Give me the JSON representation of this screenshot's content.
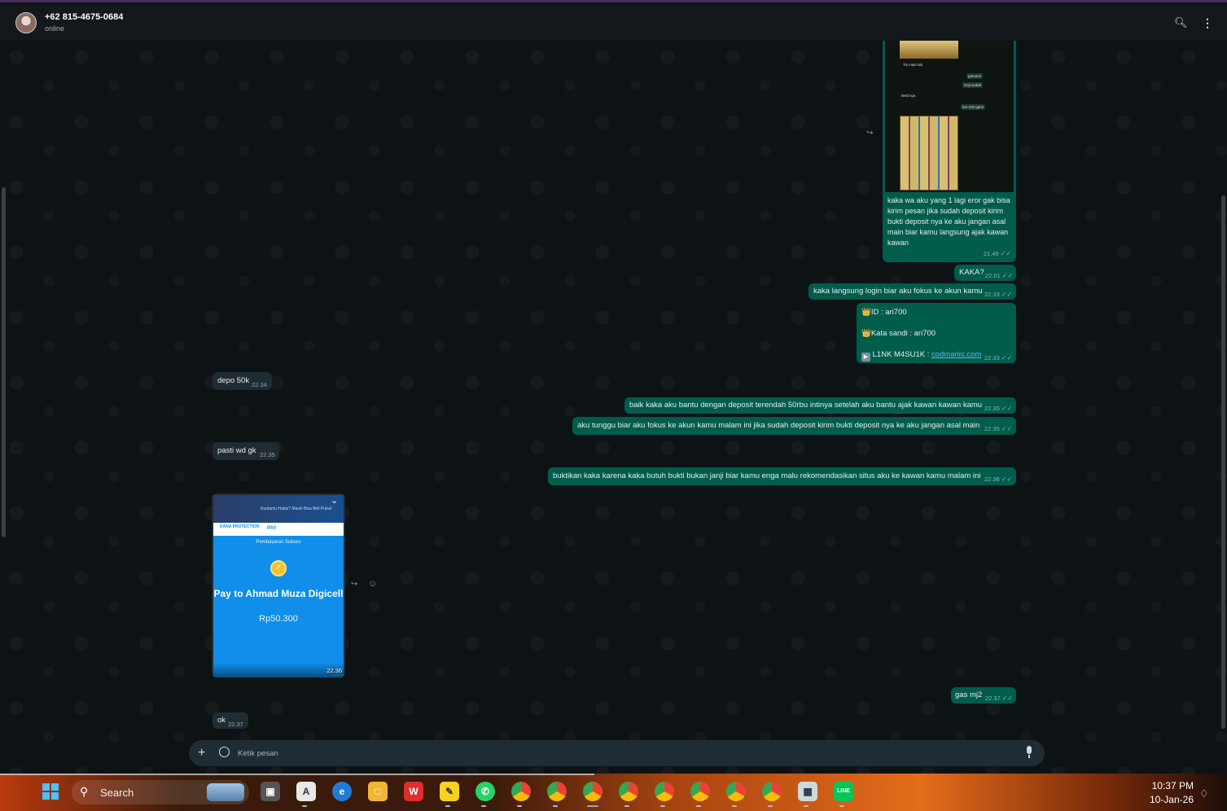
{
  "header": {
    "contact_name": "+62 815-4675-0684",
    "status": "online",
    "search_icon": "search-icon",
    "menu_icon": "kebab-menu-icon"
  },
  "messages": {
    "img_caption": "kaka wa aku yang 1 lagi eror gak bisa kirim pesan jika sudah deposit kirim bukti deposit nya ke aku jangan asal main biar kamu langsung ajak kawan kawan",
    "img_time": "21.49",
    "m_kaka": {
      "text": "KAKA?",
      "time": "22.01"
    },
    "m_login": {
      "text": "kaka langsung login biar aku fokus ke akun kamu",
      "time": "22.33"
    },
    "m_creds": {
      "id_line": "👑ID :  ari700",
      "pass_line": "👑Kata sandi : ari700",
      "link_label": "L1NK M4SU1K : ",
      "link_url": "codmanis.com",
      "time": "22.33"
    },
    "m_depo": {
      "text": "depo 50k",
      "time": "22.34"
    },
    "m_bantu": {
      "text": "baik kaka aku bantu dengan deposit terendah 50rbu intinya setelah aku bantu ajak kawan kawan kamu",
      "time": "22.35"
    },
    "m_tunggu": {
      "text": "aku tunggu biar aku fokus ke akun kamu malam ini jika sudah deposit kirim bukti deposit nya ke aku jangan asal main",
      "time": "22.35"
    },
    "m_pasti": {
      "text": "pasti wd gk",
      "time": "22.35"
    },
    "m_buktikan": {
      "text": "buktikan kaka karena kaka butuh bukti bukan janji biar kamu enga malu rekomendasikan situs aku ke kawan kamu malam ini",
      "time": "22.36"
    },
    "m_gas": {
      "text": "gas mj2",
      "time": "22.37"
    },
    "m_ok": {
      "text": "ok",
      "time": "22.37"
    },
    "tick": "✓✓"
  },
  "receipt": {
    "banner_text": "Kuotamu Habis? Masih Bisa Beli Pulsa!",
    "dana_label": "DANA PROTECTION",
    "pay_label": "PAY",
    "success_label": "Pembayaran Sukses",
    "pay_to": "Pay to Ahmad Muza Digicell",
    "amount": "Rp50.300",
    "time": "22.36"
  },
  "composer": {
    "placeholder": "Ketik pesan"
  },
  "taskbar": {
    "search_label": "Search",
    "time": "10:37 PM",
    "date": "10-Jan-26"
  },
  "colors": {
    "outgoing_bubble": "#005c4b",
    "incoming_bubble": "#202c33",
    "chat_background": "#0d1215",
    "read_tick": "#53bdeb",
    "dana_blue": "#108ee9"
  }
}
